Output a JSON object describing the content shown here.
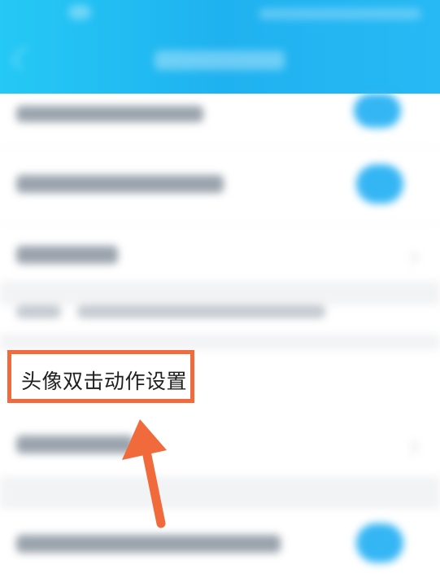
{
  "header": {
    "title": "",
    "background": "#1fb2f0"
  },
  "settings_list": {
    "highlighted_item": {
      "label": "头像双击动作设置",
      "outline_color": "#f06a3c"
    }
  },
  "annotation": {
    "arrow_icon": "arrow-up-icon",
    "color": "#f06a3c"
  }
}
